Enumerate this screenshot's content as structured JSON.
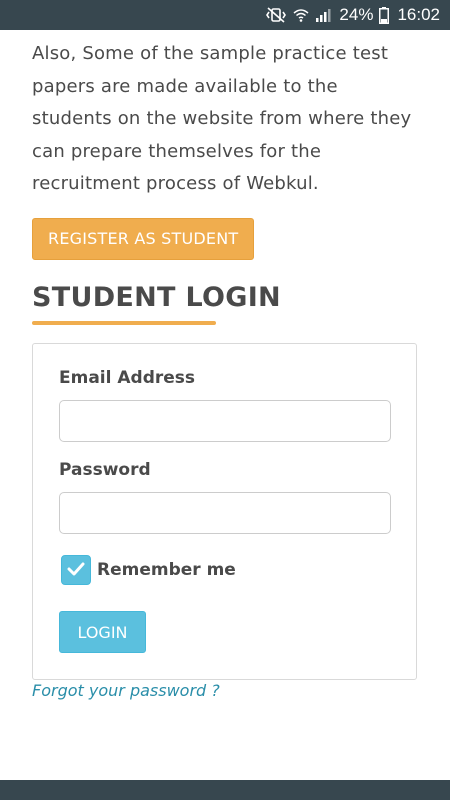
{
  "status_bar": {
    "battery_percent": "24%",
    "time": "16:02",
    "icons": [
      "mute-vibrate-icon",
      "wifi-icon",
      "signal-icon",
      "battery-icon"
    ]
  },
  "intro": {
    "text": "Also, Some of the sample practice test papers are made available to the students on the website from where they can prepare themselves for the recruitment process of Webkul."
  },
  "register_button": {
    "label": "REGISTER AS STUDENT"
  },
  "login_section": {
    "title": "STUDENT LOGIN",
    "email_label": "Email Address",
    "email_value": "",
    "password_label": "Password",
    "password_value": "",
    "remember_label": "Remember me",
    "remember_checked": true,
    "login_button": "LOGIN",
    "forgot_link": "Forgot your password ?"
  },
  "colors": {
    "accent_orange": "#f0ad4e",
    "accent_blue": "#5bc0de",
    "link": "#2a8ea9",
    "status_bar": "#37474f"
  }
}
